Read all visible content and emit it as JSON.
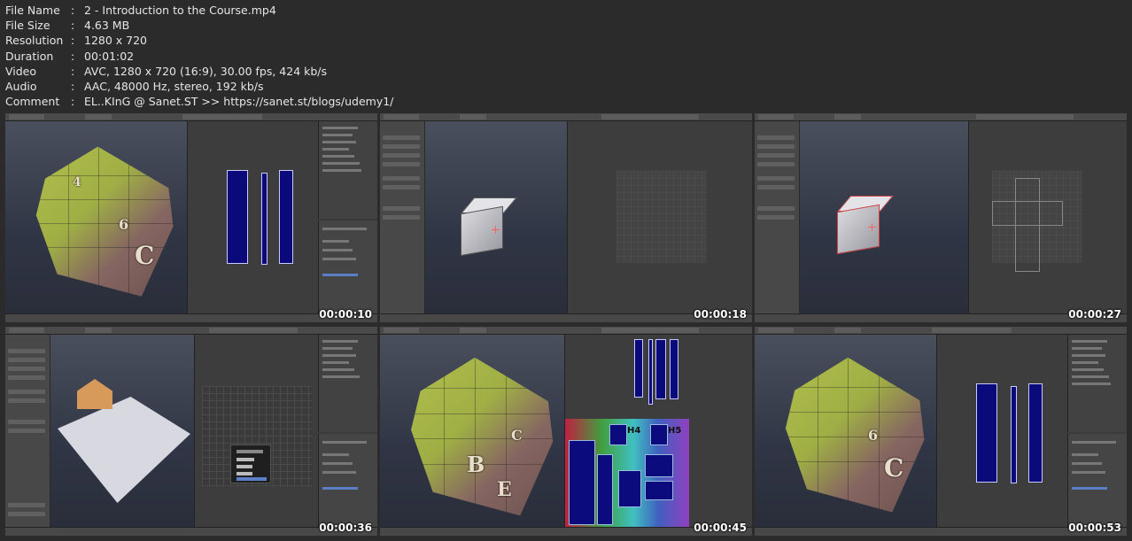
{
  "metadata": [
    {
      "key": "File Name",
      "sep": ":",
      "value": "2 - Introduction to the Course.mp4"
    },
    {
      "key": "File Size",
      "sep": ":",
      "value": "4.63 MB"
    },
    {
      "key": "Resolution",
      "sep": ":",
      "value": "1280 x 720"
    },
    {
      "key": "Duration",
      "sep": ":",
      "value": "00:01:02"
    },
    {
      "key": "Video",
      "sep": ":",
      "value": "AVC, 1280 x 720 (16:9), 30.00 fps, 424 kb/s"
    },
    {
      "key": "Audio",
      "sep": ":",
      "value": "AAC, 48000 Hz, stereo, 192 kb/s"
    },
    {
      "key": "Comment",
      "sep": ":",
      "value": "EL..KInG @ Sanet.ST >> https://sanet.st/blogs/udemy1/"
    }
  ],
  "thumbnails": [
    {
      "timestamp": "00:00:10",
      "scene": "house-uv-strips"
    },
    {
      "timestamp": "00:00:18",
      "scene": "cube-empty-uv"
    },
    {
      "timestamp": "00:00:27",
      "scene": "cube-unwrapped-uv"
    },
    {
      "timestamp": "00:00:36",
      "scene": "garden-uv-select-mode"
    },
    {
      "timestamp": "00:00:45",
      "scene": "house-uv-colored-map"
    },
    {
      "timestamp": "00:00:53",
      "scene": "house-uv-strips"
    }
  ],
  "house_glyphs": [
    "4",
    "C",
    "B",
    "6",
    "C",
    "E"
  ],
  "uv_map_labels": [
    "H4",
    "H5"
  ],
  "colors": {
    "background": "#2b2b2b",
    "text": "#e6e6e6",
    "uv_island": "#0a0a7a",
    "viewport_top": "#4a4f5c",
    "viewport_bottom": "#2a2e3a"
  }
}
